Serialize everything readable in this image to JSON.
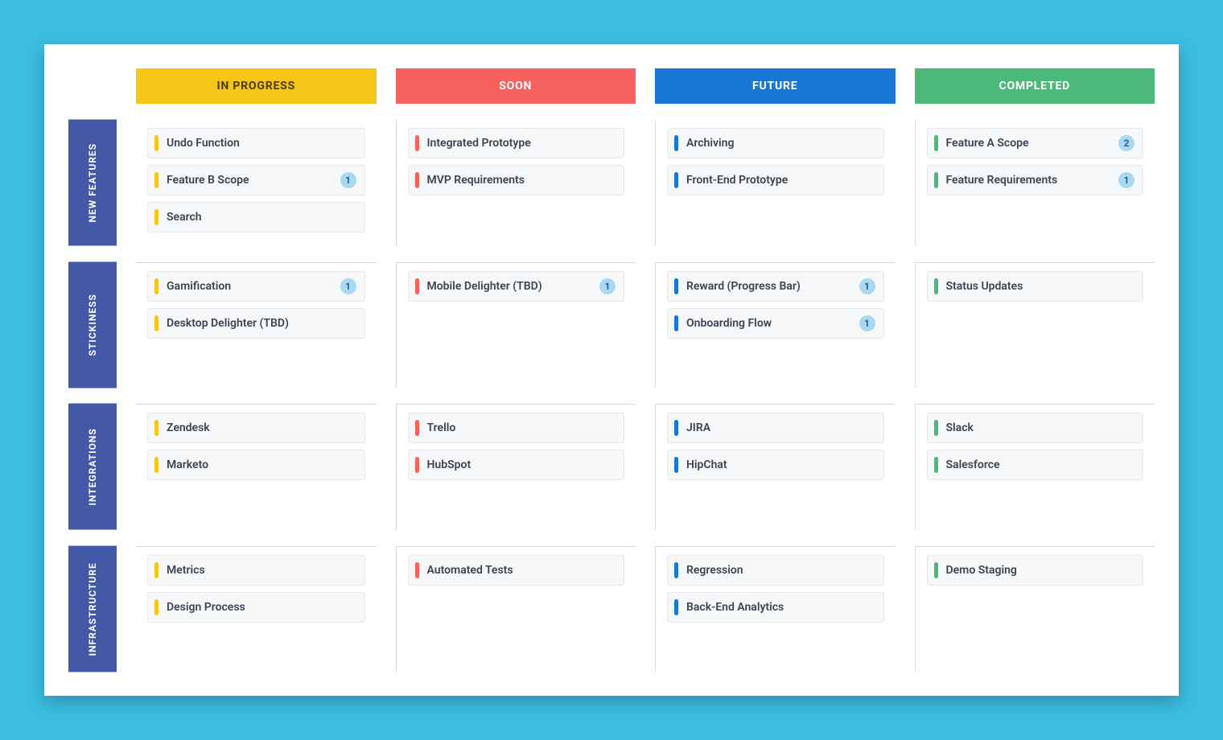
{
  "columns": [
    {
      "id": "in-progress",
      "label": "IN PROGRESS"
    },
    {
      "id": "soon",
      "label": "SOON"
    },
    {
      "id": "future",
      "label": "FUTURE"
    },
    {
      "id": "completed",
      "label": "COMPLETED"
    }
  ],
  "rows": [
    {
      "id": "new-features",
      "label": "NEW FEATURES"
    },
    {
      "id": "stickiness",
      "label": "STICKINESS"
    },
    {
      "id": "integrations",
      "label": "INTEGRATIONS"
    },
    {
      "id": "infrastructure",
      "label": "INFRASTRUCTURE"
    }
  ],
  "cells": {
    "new-features": {
      "in-progress": [
        {
          "title": "Undo Function"
        },
        {
          "title": "Feature B Scope",
          "badge": 1
        },
        {
          "title": "Search"
        }
      ],
      "soon": [
        {
          "title": "Integrated Prototype"
        },
        {
          "title": "MVP Requirements"
        }
      ],
      "future": [
        {
          "title": "Archiving"
        },
        {
          "title": "Front-End Prototype"
        }
      ],
      "completed": [
        {
          "title": "Feature A Scope",
          "badge": 2
        },
        {
          "title": "Feature Requirements",
          "badge": 1
        }
      ]
    },
    "stickiness": {
      "in-progress": [
        {
          "title": "Gamification",
          "badge": 1
        },
        {
          "title": "Desktop Delighter (TBD)"
        }
      ],
      "soon": [
        {
          "title": "Mobile Delighter (TBD)",
          "badge": 1
        }
      ],
      "future": [
        {
          "title": "Reward (Progress Bar)",
          "badge": 1
        },
        {
          "title": "Onboarding Flow",
          "badge": 1
        }
      ],
      "completed": [
        {
          "title": "Status Updates"
        }
      ]
    },
    "integrations": {
      "in-progress": [
        {
          "title": "Zendesk"
        },
        {
          "title": "Marketo"
        }
      ],
      "soon": [
        {
          "title": "Trello"
        },
        {
          "title": "HubSpot"
        }
      ],
      "future": [
        {
          "title": "JIRA"
        },
        {
          "title": "HipChat"
        }
      ],
      "completed": [
        {
          "title": "Slack"
        },
        {
          "title": "Salesforce"
        }
      ]
    },
    "infrastructure": {
      "in-progress": [
        {
          "title": "Metrics"
        },
        {
          "title": "Design Process"
        }
      ],
      "soon": [
        {
          "title": "Automated Tests"
        }
      ],
      "future": [
        {
          "title": "Regression"
        },
        {
          "title": "Back-End Analytics"
        }
      ],
      "completed": [
        {
          "title": "Demo Staging"
        }
      ]
    }
  }
}
